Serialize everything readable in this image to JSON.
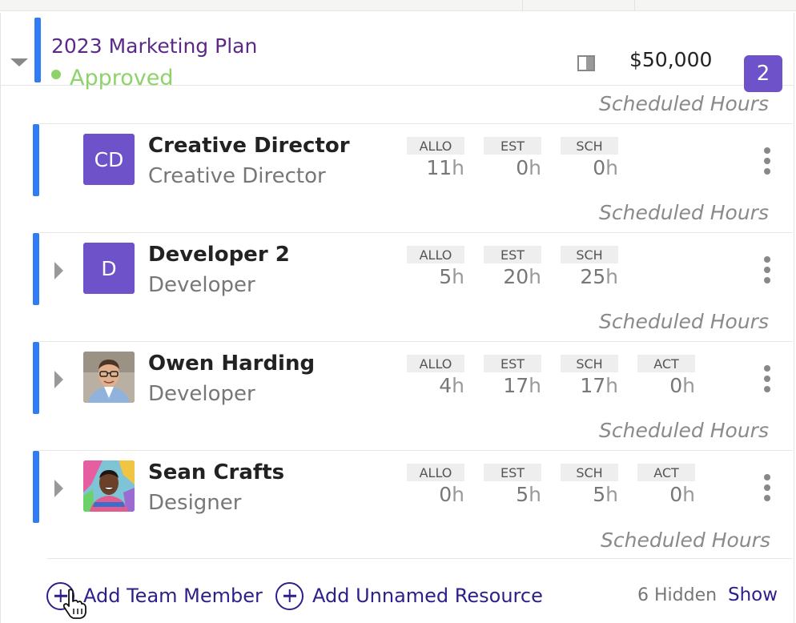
{
  "project": {
    "title": "2023 Marketing Plan",
    "status": "Approved",
    "status_color": "#8ed36a",
    "budget": "$50,000",
    "member_count": "2",
    "accent_color": "#2f7cf6",
    "badge_color": "#6d52c9"
  },
  "section_label": "Scheduled Hours",
  "members": [
    {
      "name": "Creative Director",
      "role": "Creative Director",
      "initials": "CD",
      "metrics": [
        {
          "label": "ALLO",
          "value": "11",
          "unit": "h"
        },
        {
          "label": "EST",
          "value": "0",
          "unit": "h"
        },
        {
          "label": "SCH",
          "value": "0",
          "unit": "h"
        }
      ]
    },
    {
      "name": "Developer 2",
      "role": "Developer",
      "initials": "D",
      "metrics": [
        {
          "label": "ALLO",
          "value": "5",
          "unit": "h"
        },
        {
          "label": "EST",
          "value": "20",
          "unit": "h"
        },
        {
          "label": "SCH",
          "value": "25",
          "unit": "h"
        }
      ]
    },
    {
      "name": "Owen Harding",
      "role": "Developer",
      "avatar": "photo-man-glasses",
      "metrics": [
        {
          "label": "ALLO",
          "value": "4",
          "unit": "h"
        },
        {
          "label": "EST",
          "value": "17",
          "unit": "h"
        },
        {
          "label": "SCH",
          "value": "17",
          "unit": "h"
        },
        {
          "label": "ACT",
          "value": "0",
          "unit": "h"
        }
      ]
    },
    {
      "name": "Sean Crafts",
      "role": "Designer",
      "avatar": "photo-man-graffiti",
      "metrics": [
        {
          "label": "ALLO",
          "value": "0",
          "unit": "h"
        },
        {
          "label": "EST",
          "value": "5",
          "unit": "h"
        },
        {
          "label": "SCH",
          "value": "5",
          "unit": "h"
        },
        {
          "label": "ACT",
          "value": "0",
          "unit": "h"
        }
      ]
    }
  ],
  "footer": {
    "add_team_member": "Add Team Member",
    "add_unnamed_resource": "Add Unnamed Resource",
    "hidden_count": "6 Hidden",
    "show_label": "Show"
  },
  "icons": {
    "collapse": "caret-down-icon",
    "expand": "caret-right-icon",
    "panel": "panel-toggle-icon",
    "more": "kebab-menu-icon",
    "add": "plus-circle-icon",
    "cursor": "hand-pointer-icon"
  }
}
